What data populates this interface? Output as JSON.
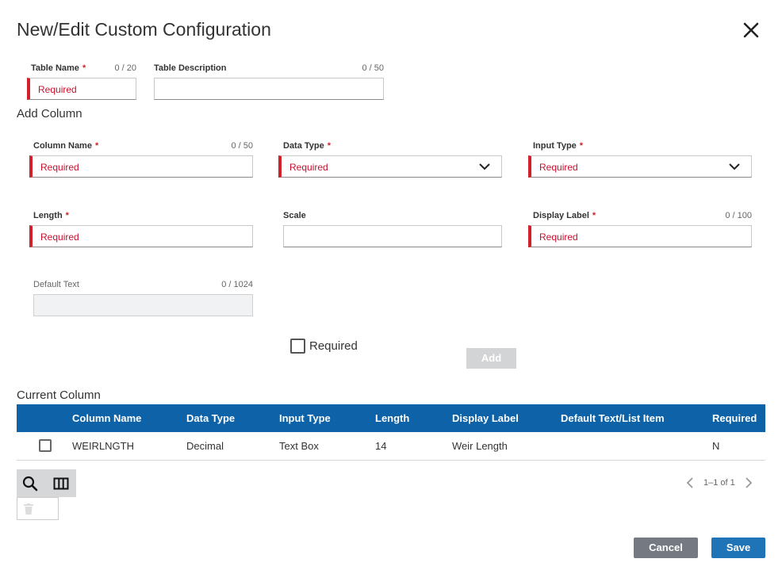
{
  "dialog": {
    "title": "New/Edit Custom Configuration"
  },
  "table": {
    "name_label": "Table Name",
    "name_counter": "0 / 20",
    "name_placeholder": "Required",
    "desc_label": "Table Description",
    "desc_counter": "0 / 50"
  },
  "add_column": {
    "heading": "Add Column",
    "column_name": {
      "label": "Column Name",
      "counter": "0 / 50",
      "placeholder": "Required"
    },
    "data_type": {
      "label": "Data Type",
      "placeholder": "Required"
    },
    "input_type": {
      "label": "Input Type",
      "placeholder": "Required"
    },
    "length": {
      "label": "Length",
      "placeholder": "Required"
    },
    "scale": {
      "label": "Scale"
    },
    "display_label": {
      "label": "Display Label",
      "counter": "0 / 100",
      "placeholder": "Required"
    },
    "default_text": {
      "label": "Default Text",
      "counter": "0 / 1024"
    },
    "required_checkbox_label": "Required",
    "add_button": "Add"
  },
  "current_column": {
    "heading": "Current Column",
    "headers": [
      "Column Name",
      "Data Type",
      "Input Type",
      "Length",
      "Display Label",
      "Default Text/List Item",
      "Required"
    ],
    "rows": [
      {
        "column_name": "WEIRLNGTH",
        "data_type": "Decimal",
        "input_type": "Text Box",
        "length": "14",
        "display_label": "Weir Length",
        "default_text": "",
        "required": "N"
      }
    ],
    "pager": "1–1 of 1"
  },
  "footer": {
    "cancel": "Cancel",
    "save": "Save"
  },
  "colors": {
    "accent": "#0e63a8",
    "error": "#d0202a",
    "save": "#1f73b7",
    "cancel": "#757a82"
  }
}
